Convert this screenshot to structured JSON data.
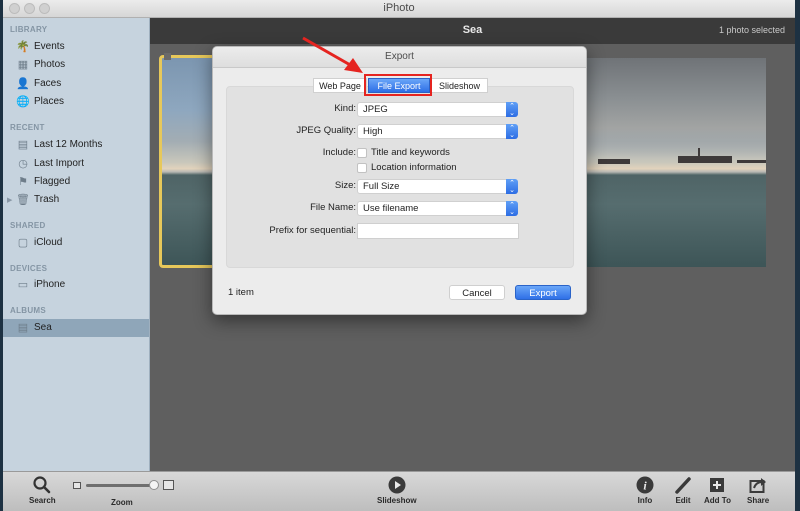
{
  "window": {
    "title": "iPhoto"
  },
  "sidebar": {
    "sections": [
      {
        "label": "LIBRARY",
        "items": [
          {
            "label": "Events",
            "icon": "palm-tree-icon"
          },
          {
            "label": "Photos",
            "icon": "photos-grid-icon"
          },
          {
            "label": "Faces",
            "icon": "person-silhouette-icon"
          },
          {
            "label": "Places",
            "icon": "globe-icon"
          }
        ]
      },
      {
        "label": "RECENT",
        "items": [
          {
            "label": "Last 12 Months",
            "icon": "calendar-icon"
          },
          {
            "label": "Last Import",
            "icon": "clock-icon"
          },
          {
            "label": "Flagged",
            "icon": "flag-icon"
          },
          {
            "label": "Trash",
            "icon": "trash-icon"
          }
        ]
      },
      {
        "label": "SHARED",
        "items": [
          {
            "label": "iCloud",
            "icon": "icloud-icon"
          }
        ]
      },
      {
        "label": "DEVICES",
        "items": [
          {
            "label": "iPhone",
            "icon": "iphone-icon"
          }
        ]
      },
      {
        "label": "ALBUMS",
        "items": [
          {
            "label": "Sea",
            "icon": "album-icon",
            "selected": true
          }
        ]
      }
    ]
  },
  "topbar": {
    "album_title": "Sea",
    "selection_count": "1 photo selected"
  },
  "dialog": {
    "title": "Export",
    "tabs": [
      {
        "label": "Web Page",
        "active": false
      },
      {
        "label": "File Export",
        "active": true
      },
      {
        "label": "Slideshow",
        "active": false
      }
    ],
    "fields": {
      "kind": {
        "label": "Kind:",
        "value": "JPEG"
      },
      "jpeg_quality": {
        "label": "JPEG Quality:",
        "value": "High"
      },
      "include": {
        "label": "Include:",
        "options": [
          {
            "label": "Title and keywords",
            "checked": false
          },
          {
            "label": "Location information",
            "checked": false
          }
        ]
      },
      "size": {
        "label": "Size:",
        "value": "Full Size"
      },
      "file_name": {
        "label": "File Name:",
        "value": "Use filename"
      },
      "prefix": {
        "label": "Prefix for sequential:",
        "value": ""
      }
    },
    "item_count": "1 item",
    "cancel_label": "Cancel",
    "export_label": "Export"
  },
  "annotation": {
    "highlight_color": "#e52420"
  },
  "toolbar": {
    "search_label": "Search",
    "zoom_label": "Zoom",
    "zoom_level_percent": 95,
    "slideshow_label": "Slideshow",
    "info_label": "Info",
    "edit_label": "Edit",
    "add_to_label": "Add To",
    "share_label": "Share"
  }
}
